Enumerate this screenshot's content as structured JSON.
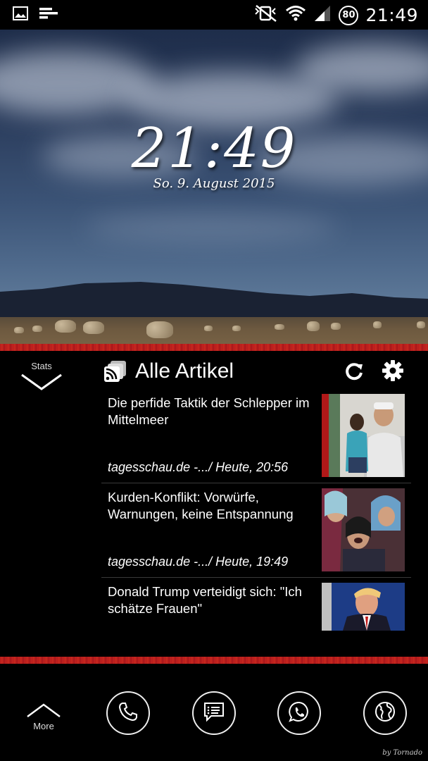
{
  "status_bar": {
    "time": "21:49",
    "battery": "80",
    "left_icons": [
      "image-icon",
      "notification-lines-icon"
    ],
    "right_icons": [
      "mute-icon",
      "wifi-icon",
      "signal-icon"
    ]
  },
  "lockscreen": {
    "clock": "21:49",
    "date": "So. 9. August 2015"
  },
  "news_widget": {
    "stats_label": "Stats",
    "title": "Alle Artikel",
    "articles": [
      {
        "title": "Die perfide Taktik der Schlepper im Mittelmeer",
        "meta": "tagesschau.de -.../ Heute, 20:56"
      },
      {
        "title": "Kurden-Konflikt: Vorwürfe, Warnungen, keine Entspannung",
        "meta": "tagesschau.de -.../ Heute, 19:49"
      },
      {
        "title": "Donald Trump verteidigt sich: \"Ich schätze Frauen\"",
        "meta": ""
      }
    ]
  },
  "dock": {
    "more_label": "More",
    "buttons": [
      "phone-icon",
      "messages-icon",
      "whatsapp-icon",
      "globe-icon"
    ],
    "credit": "by Tornado"
  },
  "colors": {
    "accent_red": "#c8281f",
    "background": "#000000",
    "text": "#ffffff"
  }
}
